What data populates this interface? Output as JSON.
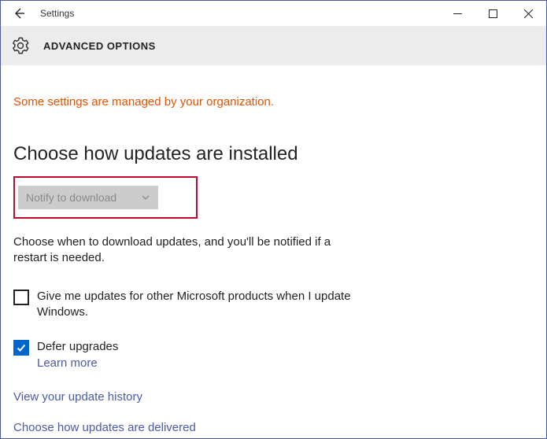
{
  "titlebar": {
    "title": "Settings"
  },
  "header": {
    "title": "ADVANCED OPTIONS"
  },
  "org_notice": "Some settings are managed by your organization.",
  "section": {
    "heading": "Choose how updates are installed",
    "dropdown_value": "Notify to download",
    "description": "Choose when to download updates, and you'll be notified if a restart is needed."
  },
  "options": {
    "other_products": {
      "label": "Give me updates for other Microsoft products when I update Windows.",
      "checked": false
    },
    "defer_upgrades": {
      "label": "Defer upgrades",
      "learn_more": "Learn more",
      "checked": true
    }
  },
  "links": {
    "history": "View your update history",
    "delivered": "Choose how updates are delivered"
  }
}
